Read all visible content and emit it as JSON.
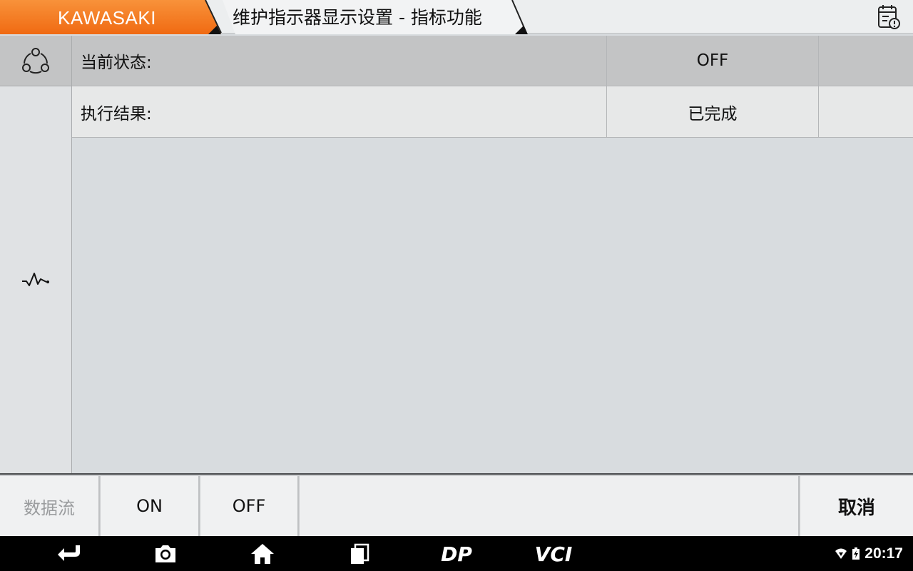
{
  "header": {
    "brand": "KAWASAKI",
    "title": "维护指示器显示设置 - 指标功能",
    "report_icon": "calendar-alert-icon"
  },
  "rail": {
    "top_icon": "connection-triangle-icon",
    "bottom_icon": "waveform-icon"
  },
  "rows": [
    {
      "name": "当前状态:",
      "value": "OFF",
      "unit": ""
    },
    {
      "name": "执行结果:",
      "value": "已完成",
      "unit": ""
    }
  ],
  "actions": {
    "data_stream": "数据流",
    "on": "ON",
    "off": "OFF",
    "cancel": "取消"
  },
  "navbar": {
    "icons": [
      "back-icon",
      "screenshot-camera-icon",
      "home-icon",
      "recent-apps-icon",
      "dp-icon",
      "vci-icon"
    ],
    "dp_label": "DP",
    "vci_label": "VCI",
    "time": "20:17"
  },
  "colors": {
    "brand_orange": "#f47a20",
    "header_bg": "#eceeef",
    "row_dark": "#c3c4c5",
    "row_light": "#e7e8e8",
    "content_bg": "#d8dcdf",
    "navbar_bg": "#000000"
  }
}
